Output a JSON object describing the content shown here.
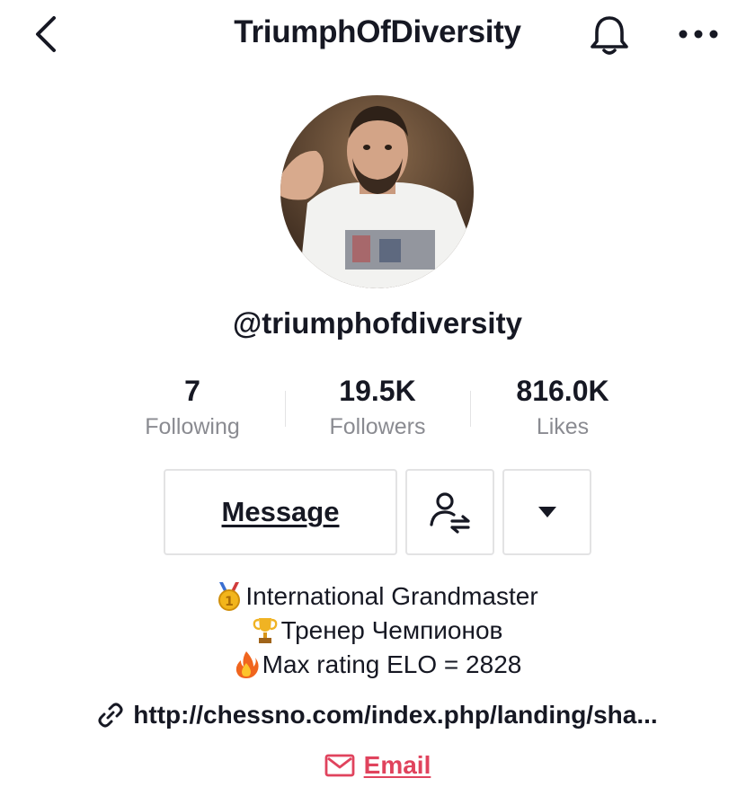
{
  "header": {
    "title": "TriumphOfDiversity",
    "back_icon": "chevron-left-icon",
    "bell_icon": "bell-icon",
    "more_icon": "more-horizontal-icon"
  },
  "profile": {
    "handle": "@triumphofdiversity",
    "avatar": "profile-photo"
  },
  "stats": [
    {
      "value": "7",
      "label": "Following"
    },
    {
      "value": "19.5K",
      "label": "Followers"
    },
    {
      "value": "816.0K",
      "label": "Likes"
    }
  ],
  "actions": {
    "message_label": "Message",
    "friends_icon": "user-swap-icon",
    "dropdown_icon": "caret-down-icon"
  },
  "bio": [
    {
      "icon": "gold-medal-emoji",
      "text": "International Grandmaster"
    },
    {
      "icon": "trophy-emoji",
      "text": "Тренер Чемпионов"
    },
    {
      "icon": "fire-emoji",
      "text": "Max rating ELO = 2828"
    }
  ],
  "link": {
    "icon": "link-icon",
    "text": "http://chessno.com/index.php/landing/sha..."
  },
  "email": {
    "icon": "envelope-icon",
    "label": "Email"
  },
  "colors": {
    "text": "#161823",
    "secondary": "#8a8b91",
    "border": "#e3e3e4",
    "accent": "#e0435d"
  }
}
